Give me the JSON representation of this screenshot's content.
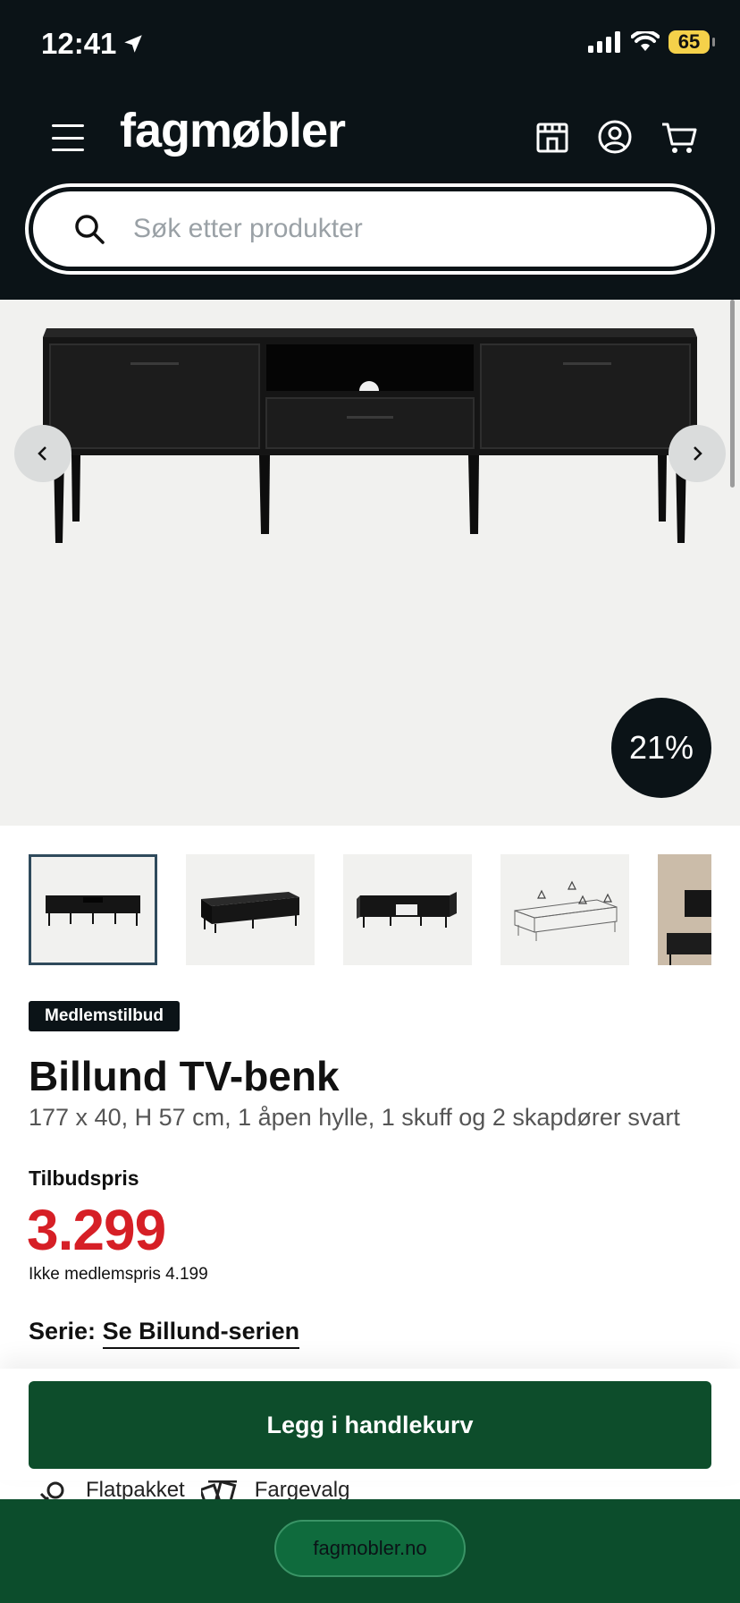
{
  "status_bar": {
    "time": "12:41",
    "battery": "65"
  },
  "header": {
    "logo": "fagmøbler"
  },
  "search": {
    "placeholder": "Søk etter produkter"
  },
  "product": {
    "discount": "21%",
    "badge": "Medlemstilbud",
    "title": "Billund TV-benk",
    "subtitle": "177 x 40, H 57 cm, 1 åpen hylle, 1 skuff og 2 skapdører svart",
    "price_label": "Tilbudspris",
    "price": "3.299",
    "nonmember_price": "Ikke medlemspris 4.199",
    "series_label": "Serie:",
    "series_link": "Se Billund-serien"
  },
  "cta": {
    "add_to_cart": "Legg i handlekurv"
  },
  "features": [
    {
      "label": "Flatpakket",
      "icon": "tools-icon"
    },
    {
      "label": "Fargevalg",
      "icon": "color-swatch-icon"
    }
  ],
  "browser": {
    "url": "fagmobler.no"
  },
  "colors": {
    "header_bg": "#0b1317",
    "price_red": "#d61f26",
    "cta_green": "#0d4d2b"
  }
}
